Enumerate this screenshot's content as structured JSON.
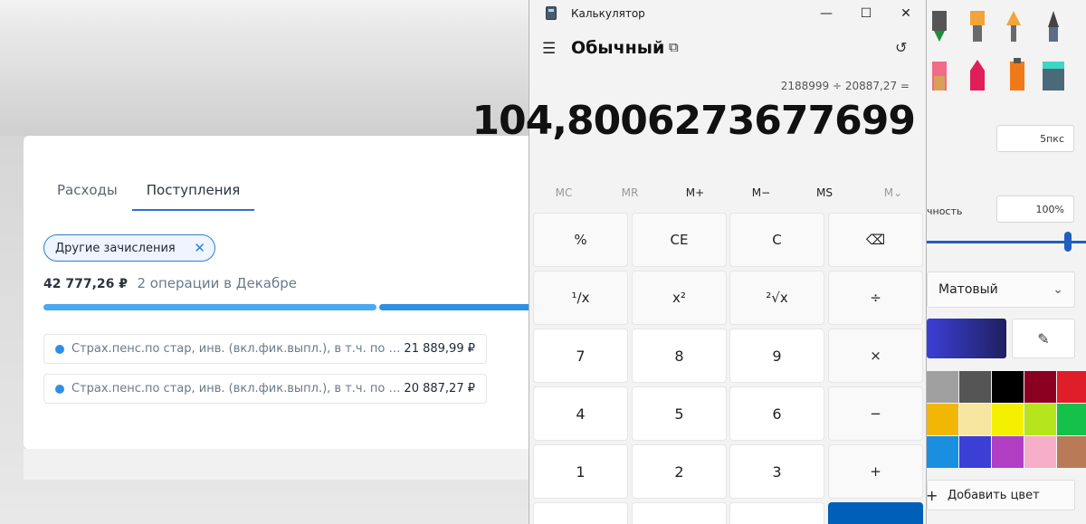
{
  "bank": {
    "tabs": [
      "Расходы",
      "Поступления"
    ],
    "active_tab": 1,
    "filter_chip": "Другие зачисления",
    "summary_amount": "42 777,26 ₽",
    "summary_ops": "2 операции в Декабре",
    "rows": [
      {
        "desc": "Страх.пенс.по стар, инв. (вкл.фик.выпл.), в т.ч. по ре...",
        "value": "21 889,99 ₽"
      },
      {
        "desc": "Страх.пенс.по стар, инв. (вкл.фик.выпл.), в т.ч. по ре...",
        "value": "20 887,27 ₽"
      }
    ],
    "accent": "#2f7ed8"
  },
  "calculator": {
    "title": "Калькулятор",
    "mode": "Обычный",
    "expression": "2188999 ÷ 20887,27 =",
    "display": "104,8006273677699",
    "memory": [
      "MC",
      "MR",
      "M+",
      "M−",
      "MS",
      "M⌄"
    ],
    "memory_enabled": [
      false,
      false,
      true,
      true,
      true,
      false
    ],
    "keys": [
      [
        "%",
        "CE",
        "C",
        "⌫"
      ],
      [
        "¹∕x",
        "x²",
        "²√x",
        "÷"
      ],
      [
        "7",
        "8",
        "9",
        "×"
      ],
      [
        "4",
        "5",
        "6",
        "−"
      ],
      [
        "1",
        "2",
        "3",
        "+"
      ]
    ],
    "equals_color": "#005fb8"
  },
  "paint": {
    "size_value": "5пкс",
    "opacity_label": "чность",
    "opacity_value": "100%",
    "texture": "Матовый",
    "add_color": "Добавить цвет",
    "palette": [
      [
        "#a0a0a0",
        "#555555",
        "#000000",
        "#8b0020",
        "#e01e2a"
      ],
      [
        "#f2b705",
        "#f7e6a0",
        "#f5f000",
        "#b5e61d",
        "#14c24b"
      ],
      [
        "#1a8fe0",
        "#3b3fd6",
        "#b03fc4",
        "#f7afc9",
        "#b97a57"
      ]
    ]
  }
}
